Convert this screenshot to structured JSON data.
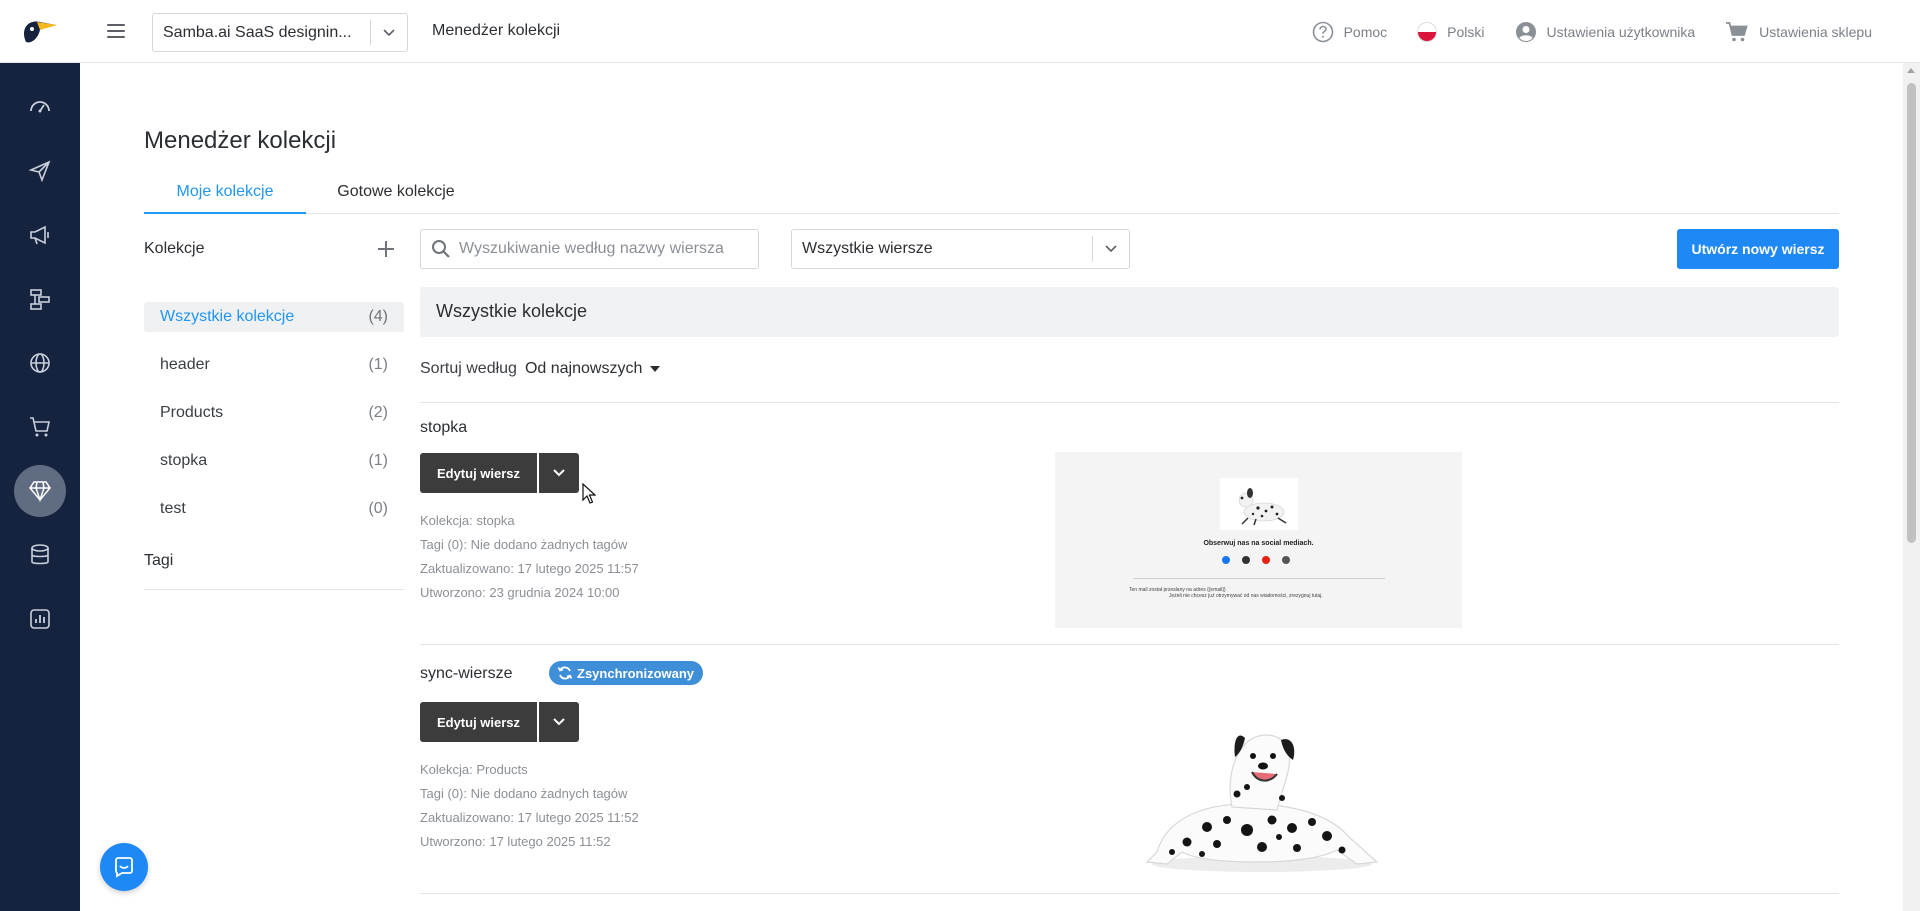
{
  "topbar": {
    "account": "Samba.ai SaaS designin...",
    "title": "Menedżer kolekcji",
    "links": {
      "help": "Pomoc",
      "language": "Polski",
      "user_settings": "Ustawienia użytkownika",
      "shop_settings": "Ustawienia sklepu"
    }
  },
  "sidebar": {
    "items": [
      "dashboard-icon",
      "plane-icon",
      "megaphone-icon",
      "workflow-icon",
      "globe-icon",
      "cart-icon",
      "diamond-icon",
      "database-icon",
      "analytics-icon"
    ],
    "active_index": 6
  },
  "page": {
    "title": "Menedżer kolekcji",
    "tabs": [
      "Moje kolekcje",
      "Gotowe kolekcje"
    ],
    "active_tab": 0
  },
  "collections_panel": {
    "heading": "Kolekcje",
    "items": [
      {
        "name": "Wszystkie kolekcje",
        "count": "(4)"
      },
      {
        "name": "header",
        "count": "(1)"
      },
      {
        "name": "Products",
        "count": "(2)"
      },
      {
        "name": "stopka",
        "count": "(1)"
      },
      {
        "name": "test",
        "count": "(0)"
      }
    ],
    "tags_heading": "Tagi"
  },
  "toolbar": {
    "search_placeholder": "Wyszukiwanie według nazwy wiersza",
    "filter_value": "Wszystkie wiersze",
    "create_button": "Utwórz nowy wiersz"
  },
  "section": {
    "heading": "Wszystkie kolekcje",
    "sort_label": "Sortuj według",
    "sort_value": "Od najnowszych"
  },
  "rows": [
    {
      "name": "stopka",
      "edit_label": "Edytuj wiersz",
      "collection": "Kolekcja: stopka",
      "tags": "Tagi (0): Nie dodano żadnych tagów",
      "updated": "Zaktualizowano: 17 lutego 2025 11:57",
      "created": "Utworzono: 23 grudnia 2024 10:00",
      "preview": {
        "title": "Obserwuj nas na social mediach.",
        "footer_line1": "Ten mail został przesłany na adres {{email}}",
        "footer_line2": "Jeżeli nie chcesz już otrzymywać od nas wiadomości, zrezygnuj tutaj."
      }
    },
    {
      "name": "sync-wiersze",
      "badge": "Zsynchronizowany",
      "edit_label": "Edytuj wiersz",
      "collection": "Kolekcja: Products",
      "tags": "Tagi (0): Nie dodano żadnych tagów",
      "updated": "Zaktualizowano: 17 lutego 2025 11:52",
      "created": "Utworzono: 17 lutego 2025 11:52"
    }
  ],
  "colors": {
    "sidebar_bg": "#15233e",
    "accent": "#1e88f5",
    "sync_badge": "#3e8fd8",
    "edit_button": "#3c3c3c"
  }
}
